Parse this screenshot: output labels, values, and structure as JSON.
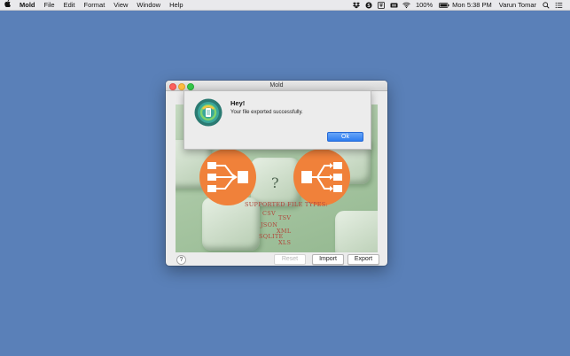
{
  "menubar": {
    "app_name": "Mold",
    "items": [
      "File",
      "Edit",
      "Format",
      "View",
      "Window",
      "Help"
    ],
    "battery": "100%",
    "datetime": "Mon 5:38 PM",
    "user": "Varun Tomar"
  },
  "window": {
    "title": "Mold",
    "supported_title": "Supported file types:",
    "types": [
      "CSV",
      "TSV",
      "JSON",
      "XML",
      "SQLITE",
      "XLS"
    ],
    "buttons": {
      "help": "?",
      "reset": "Reset",
      "import": "Import",
      "export": "Export"
    }
  },
  "alert": {
    "heading": "Hey!",
    "message": "Your file exported successfully.",
    "ok": "Ok"
  },
  "colors": {
    "desktop": "#5a80b8",
    "orange": "#f0813a",
    "accent": "#2d7df0",
    "types_text": "#b0463a"
  }
}
